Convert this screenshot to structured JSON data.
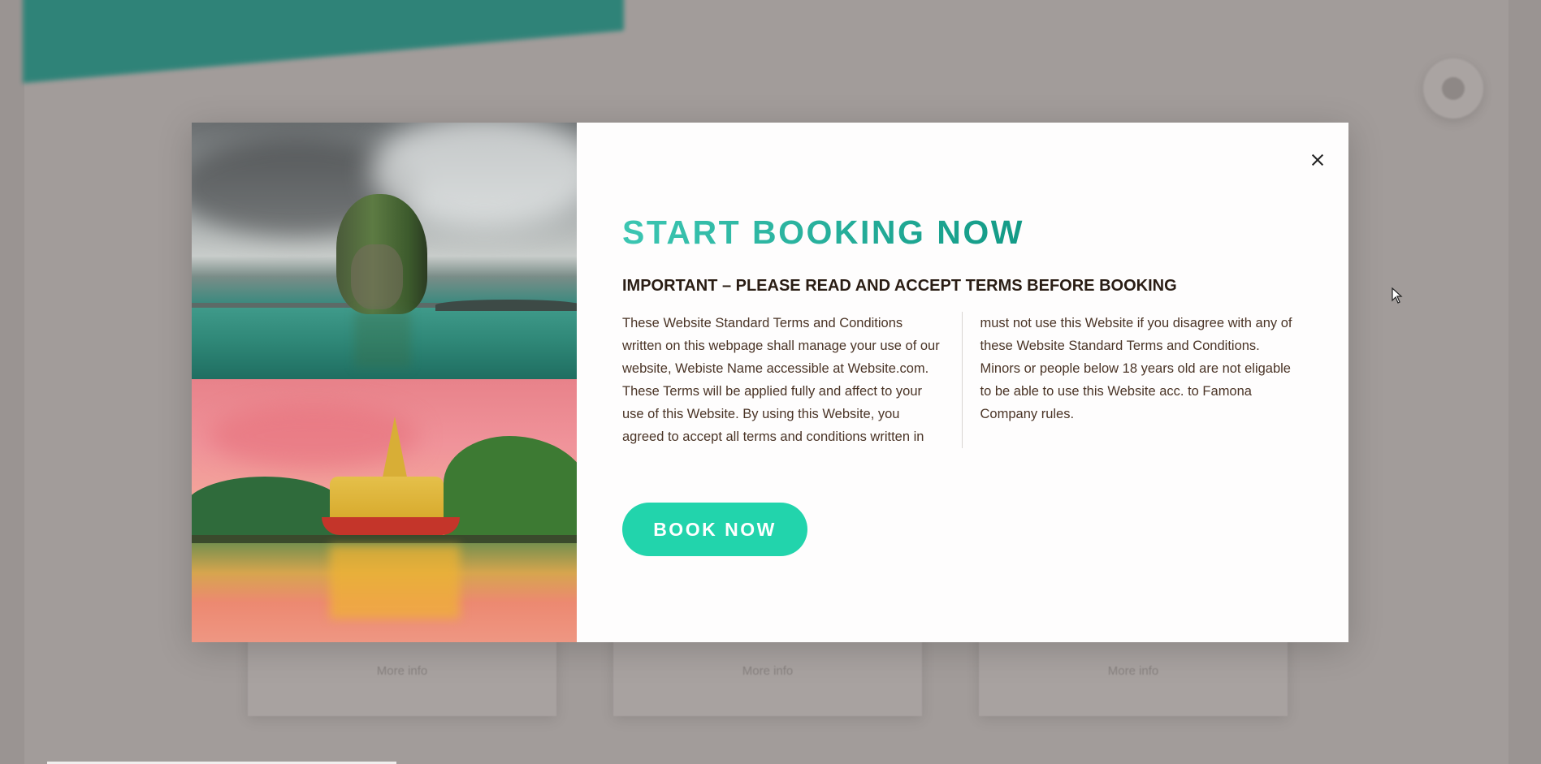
{
  "background": {
    "cards": [
      {
        "label": "More info"
      },
      {
        "label": "More info"
      },
      {
        "label": "More info"
      }
    ]
  },
  "modal": {
    "title": "START BOOKING NOW",
    "subtitle": "IMPORTANT – PLEASE READ AND ACCEPT TERMS BEFORE BOOKING",
    "terms_left": "These Website Standard Terms and Conditions written on this webpage shall manage your use of our website, Webiste Name accessible at Website.com. These Terms will be applied fully and affect to your use of this Website. By using this Website, you agreed to accept all terms and conditions written in here. You",
    "terms_right": "must not use this Website if you disagree with any of these Website Standard Terms and Conditions. Minors or people below 18 years old are not eligable to be able to use this Website acc. to Famona Company rules.",
    "book_button_label": "BOOK NOW",
    "close_icon": "close-icon",
    "images": [
      "sea-rock-island-photo",
      "golden-palace-lake-photo"
    ]
  },
  "colors": {
    "title_gradient_start": "#3cc6b2",
    "title_gradient_end": "#139a86",
    "button_bg": "#22d4ac",
    "overlay": "#a29c9a"
  }
}
